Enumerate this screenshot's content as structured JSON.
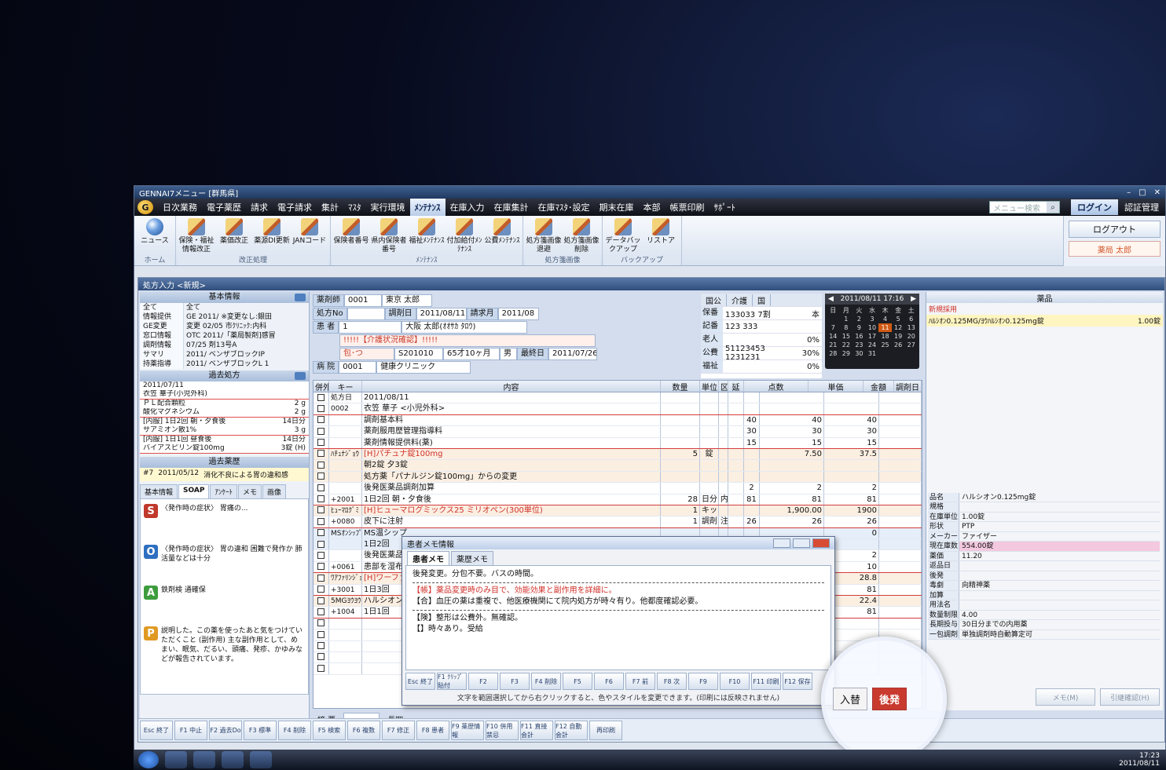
{
  "window": {
    "title": "GENNAI7メニュー [群馬県]"
  },
  "menu": {
    "items": [
      "日次業務",
      "電子薬歴",
      "請求",
      "電子請求",
      "集計",
      "ﾏｽﾀ",
      "実行環境",
      "ﾒﾝﾃﾅﾝｽ",
      "在庫入力",
      "在庫集計",
      "在庫ﾏｽﾀ･設定",
      "期末在庫",
      "本部",
      "帳票印刷",
      "ｻﾎﾟｰﾄ"
    ],
    "active_index": 7,
    "search_placeholder": "メニュー検索",
    "login": "ログイン",
    "auth": "認証管理"
  },
  "ribbon": {
    "groups": [
      {
        "label": "ホーム",
        "buttons": [
          "ニュース"
        ]
      },
      {
        "label": "改正処理",
        "buttons": [
          "保険・福祉情報改正",
          "薬価改正",
          "薬源DI更新",
          "JANコード"
        ]
      },
      {
        "label": "ﾒﾝﾃﾅﾝｽ",
        "buttons": [
          "保険者番号",
          "県内保険者番号",
          "福祉ﾒﾝﾃﾅﾝｽ",
          "付加給付ﾒﾝﾃﾅﾝｽ",
          "公費ﾒﾝﾃﾅﾝｽ"
        ]
      },
      {
        "label": "処方箋画像",
        "buttons": [
          "処方箋画像退避",
          "処方箋画像削除"
        ]
      },
      {
        "label": "バックアップ",
        "buttons": [
          "データバックアップ",
          "リストア"
        ]
      }
    ],
    "logout": "ログアウト",
    "user": "薬局 太郎"
  },
  "subwin": {
    "title": "処方入力 <新規>"
  },
  "left": {
    "basic_head": "基本情報",
    "basic": [
      {
        "k": "全て",
        "v": "全て"
      },
      {
        "k": "情報提供",
        "v": "GE  2011/ ※変更なし:銀田"
      },
      {
        "k": "GE変更",
        "v": "変更 02/05 市ｸﾘﾆｯｸ:内科"
      },
      {
        "k": "窓口情報",
        "v": "OTC 2011/「薬局製剤]感冒"
      },
      {
        "k": "調剤情報",
        "v": "07/25 剤13号A"
      },
      {
        "k": "サマリ",
        "v": "2011/ ベンザブロックIP"
      },
      {
        "k": "持薬指導",
        "v": "2011/ ベンザブロックL 1"
      }
    ],
    "past_head": "過去処方",
    "past": [
      {
        "d": "2011/07/11",
        "n": ""
      },
      {
        "d": "衣笠 華子(小児外科)",
        "n": ""
      },
      {
        "d": "ＰＬ配合顆粒",
        "n": "2 g"
      },
      {
        "d": "酸化マグネシウム",
        "n": "2 g"
      },
      {
        "d": "[内服] 1日2回 朝・夕食後",
        "n": "14日分"
      },
      {
        "d": "サアミオン散1%",
        "n": "3 g"
      },
      {
        "d": "[内服] 1日1回 昼食後",
        "n": "14日分"
      },
      {
        "d": "バイアスピリン錠100mg",
        "n": "3錠 (H)"
      }
    ],
    "hist_head": "過去薬歴",
    "hist": {
      "no": "#7",
      "date": "2011/05/12",
      "text": "消化不良による胃の違和感"
    },
    "tabs": [
      "基本情報",
      "SOAP",
      "ｱﾝｹｰﾄ",
      "メモ",
      "画像"
    ],
    "soap": [
      {
        "letter": "S",
        "color": "#c0392b",
        "text": "〈発作時の症状〉 胃痛の..."
      },
      {
        "letter": "O",
        "color": "#2e6fc0",
        "text": "〈発作時の症状〉 胃の違和 困難で発作か 肺活量などは十分"
      },
      {
        "letter": "A",
        "color": "#3d9d3d",
        "text": "鉄剤検 通確保"
      },
      {
        "letter": "P",
        "color": "#e09a22",
        "text": "説明した。この薬を使ったあと気をつけていただくこと (副作用) 主な副作用として、めまい、眠気、だるい、頭痛、発疹、かゆみなどが報告されています。"
      }
    ],
    "nav": [
      "初回",
      "前",
      "次",
      "直近"
    ]
  },
  "header": {
    "pharmacist_label": "薬剤師",
    "pharmacist_no": "0001",
    "pharmacist_name": "東京 太郎",
    "rx_label": "処方No",
    "dispense_label": "調剤日",
    "dispense_date": "2011/08/11",
    "claim_label": "請求月",
    "claim_month": "2011/08",
    "patient_label": "患 者",
    "patient_no": "1",
    "patient_name": "大阪 太郎(ｵｵｻｶ ﾀﾛｳ)",
    "alert": "!!!!!【介護状況確認】!!!!!",
    "pkg": "包･つ",
    "code": "S201010",
    "age": "65才10ヶ月",
    "sex": "男",
    "last_label": "最終日",
    "last_date": "2011/07/26",
    "hospital_label": "病 院",
    "hospital_no": "0001",
    "hospital_name": "健康クリニック"
  },
  "insurance": {
    "tabs": [
      "国公",
      "介護",
      "国"
    ],
    "rows": [
      {
        "a": "保番",
        "b": "133033  7割",
        "c": "本"
      },
      {
        "a": "記番",
        "b": "123 333",
        "c": ""
      },
      {
        "a": "老人",
        "b": "",
        "c": "0%"
      },
      {
        "a": "公費",
        "b": "51123453 1231231",
        "c": "30%"
      },
      {
        "a": "福祉",
        "b": "",
        "c": "0%"
      }
    ]
  },
  "calendar": {
    "head": "2011/08/11 17:16",
    "days": [
      "日",
      "月",
      "火",
      "水",
      "木",
      "金",
      "土"
    ],
    "dates": [
      "",
      "1",
      "2",
      "3",
      "4",
      "5",
      "6",
      "7",
      "8",
      "9",
      "10",
      "11",
      "12",
      "13",
      "14",
      "15",
      "16",
      "17",
      "18",
      "19",
      "20",
      "21",
      "22",
      "23",
      "24",
      "25",
      "26",
      "27",
      "28",
      "29",
      "30",
      "31",
      "",
      "",
      ""
    ],
    "today": "11"
  },
  "grid": {
    "headers": [
      "併外",
      "キー",
      "内容",
      "数量",
      "単位",
      "区",
      "延",
      "点数",
      "単価",
      "金額",
      "調剤日"
    ],
    "rows": [
      {
        "k": "処方日",
        "c": "2011/08/11",
        "q": "",
        "u": "",
        "t": "",
        "d": "",
        "p": "",
        "pr": "",
        "a": "",
        "cls": "",
        "tx": ""
      },
      {
        "k": "0002",
        "c": "衣笠 華子 <小児外科>",
        "q": "",
        "u": "",
        "t": "",
        "d": "",
        "p": "",
        "pr": "",
        "a": "",
        "cls": "red",
        "tx": ""
      },
      {
        "k": "",
        "c": "調剤基本料",
        "q": "",
        "u": "",
        "t": "",
        "d": "",
        "p": "40",
        "pr": "40",
        "a": "40",
        "cls": "",
        "tx": ""
      },
      {
        "k": "",
        "c": "薬剤服用歴管理指導料",
        "q": "",
        "u": "",
        "t": "",
        "d": "",
        "p": "30",
        "pr": "30",
        "a": "30",
        "cls": "",
        "tx": ""
      },
      {
        "k": "",
        "c": "薬剤情報提供料(薬)",
        "q": "",
        "u": "",
        "t": "",
        "d": "",
        "p": "15",
        "pr": "15",
        "a": "15",
        "cls": "red",
        "tx": ""
      },
      {
        "k": "ﾊﾁｭﾅｼﾞｮｳ",
        "c": "[H]パチュナ錠100mg",
        "q": "5",
        "u": "錠",
        "t": "",
        "d": "",
        "p": "",
        "pr": "7.50",
        "a": "37.5",
        "cls": "beige",
        "tx": "red"
      },
      {
        "k": "",
        "c": "朝2錠 夕3錠",
        "q": "",
        "u": "",
        "t": "",
        "d": "",
        "p": "",
        "pr": "",
        "a": "",
        "cls": "beige",
        "tx": ""
      },
      {
        "k": "",
        "c": "処方薬「パナルジン錠100mg」からの変更",
        "q": "",
        "u": "",
        "t": "",
        "d": "",
        "p": "",
        "pr": "",
        "a": "",
        "cls": "beige",
        "tx": ""
      },
      {
        "k": "",
        "c": "後発医薬品調剤加算",
        "q": "",
        "u": "",
        "t": "",
        "d": "",
        "p": "2",
        "pr": "2",
        "a": "2",
        "cls": "",
        "tx": ""
      },
      {
        "k": "+2001",
        "c": "1日2回 朝・夕食後",
        "q": "28",
        "u": "日分",
        "t": "内",
        "d": "",
        "p": "81",
        "pr": "81",
        "a": "81",
        "cls": "red",
        "tx": ""
      },
      {
        "k": "ﾋｭｰﾏﾛｸﾞﾐ",
        "c": "[H]ヒューマログミックス25 ミリオペン(300単位)",
        "q": "1",
        "u": "キッ",
        "t": "",
        "d": "",
        "p": "",
        "pr": "1,900.00",
        "a": "1900",
        "cls": "beige",
        "tx": "red"
      },
      {
        "k": "+0080",
        "c": "皮下に注射",
        "q": "1",
        "u": "調剤",
        "t": "注",
        "d": "",
        "p": "26",
        "pr": "26",
        "a": "26",
        "cls": "red",
        "tx": ""
      },
      {
        "k": "MSｵﾝｼｯﾌﾟ",
        "c": "MS温シップ",
        "q": "",
        "u": "",
        "t": "",
        "d": "",
        "p": "",
        "pr": "",
        "a": "0",
        "cls": "blue",
        "tx": ""
      },
      {
        "k": "",
        "c": "1日2回",
        "q": "",
        "u": "",
        "t": "",
        "d": "",
        "p": "",
        "pr": "",
        "a": "",
        "cls": "blue",
        "tx": ""
      },
      {
        "k": "",
        "c": "後発医薬品調剤加算",
        "q": "",
        "u": "",
        "t": "",
        "d": "",
        "p": "",
        "pr": "",
        "a": "2",
        "cls": "",
        "tx": ""
      },
      {
        "k": "+0061",
        "c": "患部を湿布",
        "q": "",
        "u": "",
        "t": "",
        "d": "",
        "p": "",
        "pr": "",
        "a": "10",
        "cls": "red",
        "tx": ""
      },
      {
        "k": "ﾜｱﾌｧﾘﾝｼﾞｮ",
        "c": "[H]ワーファリン錠",
        "q": "",
        "u": "",
        "t": "",
        "d": "",
        "p": "",
        "pr": "",
        "a": "28.8",
        "cls": "beige",
        "tx": "red"
      },
      {
        "k": "+3001",
        "c": "1日3回",
        "q": "",
        "u": "",
        "t": "",
        "d": "",
        "p": "",
        "pr": "",
        "a": "81",
        "cls": "red",
        "tx": ""
      },
      {
        "k": "5MGﾖｳﾖｳ",
        "c": "ハルシオン",
        "q": "",
        "u": "",
        "t": "",
        "d": "",
        "p": "",
        "pr": "",
        "a": "22.4",
        "cls": "beige",
        "tx": ""
      },
      {
        "k": "+1004",
        "c": "1日1回",
        "q": "",
        "u": "",
        "t": "",
        "d": "",
        "p": "",
        "pr": "",
        "a": "81",
        "cls": "red",
        "tx": ""
      },
      {
        "k": "",
        "c": "",
        "q": "",
        "u": "",
        "t": "",
        "d": "",
        "p": "",
        "pr": "",
        "a": "",
        "cls": "",
        "tx": ""
      },
      {
        "k": "",
        "c": "",
        "q": "",
        "u": "",
        "t": "",
        "d": "",
        "p": "",
        "pr": "",
        "a": "",
        "cls": "",
        "tx": ""
      },
      {
        "k": "",
        "c": "",
        "q": "",
        "u": "",
        "t": "",
        "d": "",
        "p": "",
        "pr": "",
        "a": "",
        "cls": "",
        "tx": ""
      },
      {
        "k": "",
        "c": "",
        "q": "",
        "u": "",
        "t": "",
        "d": "",
        "p": "",
        "pr": "",
        "a": "",
        "cls": "",
        "tx": ""
      },
      {
        "k": "",
        "c": "",
        "q": "",
        "u": "",
        "t": "",
        "d": "",
        "p": "",
        "pr": "",
        "a": "",
        "cls": "",
        "tx": ""
      }
    ]
  },
  "summary": {
    "label": "摘 要",
    "label2": "長期"
  },
  "fkeys": [
    "Esc 終了",
    "F1 中止",
    "F2 過去Do",
    "F3 標準",
    "F4 削除",
    "F5 検索",
    "F6 複数",
    "F7 修正",
    "F8 患者",
    "F9 薬歴情報",
    "F10 併用禁忌",
    "F11 直接会計",
    "F12 自動会計",
    "再印刷"
  ],
  "right": {
    "head": "薬品",
    "newtag": "新規採用",
    "drug": "ﾊﾙｼｵﾝ0.125MG/ﾖｳﾊﾙｼｵﾝ0.125mg錠",
    "qty": "1.00錠",
    "details": [
      {
        "k": "品名",
        "v": "ハルシオン0.125mg錠",
        "pink": false
      },
      {
        "k": "規格",
        "v": "",
        "pink": false
      },
      {
        "k": "在庫単位",
        "v": "1.00錠",
        "pink": false
      },
      {
        "k": "形状",
        "v": "PTP",
        "pink": false
      },
      {
        "k": "メーカー",
        "v": "ファイザー",
        "pink": false
      },
      {
        "k": "現在庫数",
        "v": "554.00錠",
        "pink": true
      },
      {
        "k": "薬価",
        "v": "11.20",
        "pink": false
      },
      {
        "k": "返品日",
        "v": "",
        "pink": false
      },
      {
        "k": "後発",
        "v": "",
        "pink": false
      },
      {
        "k": "毒劇",
        "v": "向精神薬",
        "pink": false
      },
      {
        "k": "加算",
        "v": "",
        "pink": false
      },
      {
        "k": "用法名",
        "v": "",
        "pink": false
      },
      {
        "k": "数量制限",
        "v": "4.00",
        "pink": false
      },
      {
        "k": "長期投与",
        "v": "30日分までの内用薬",
        "pink": false
      },
      {
        "k": "一包調剤",
        "v": "単独調剤時自動算定可",
        "pink": false
      }
    ],
    "btn1": "メモ(M)",
    "btn2": "引継確認(H)"
  },
  "popup": {
    "title": "患者メモ情報",
    "tabs": [
      "患者メモ",
      "薬歴メモ"
    ],
    "lines": [
      {
        "t": "後発変更。分包不要。バスの時間。",
        "red": false
      },
      {
        "t": "dash",
        "red": false
      },
      {
        "t": "【帳】薬品変更時のみ目で、効能効果と副作用を詳細に。",
        "red": true
      },
      {
        "t": "【合】血圧の薬は重複で、他医療機関にて院内処方が時々有り。他都度確認必要。",
        "red": false
      },
      {
        "t": "dash",
        "red": false
      },
      {
        "t": "【険】整形は公費外。無確認。",
        "red": false
      },
      {
        "t": "【】時々あり。受給",
        "red": false
      }
    ],
    "fkeys": [
      "Esc 終了",
      "F1 ｸﾘｯﾌﾟ貼付",
      "F2",
      "F3",
      "F4 削除",
      "F5",
      "F6",
      "F7 前",
      "F8 次",
      "F9",
      "F10",
      "F11 印刷",
      "F12 保存"
    ],
    "hint": "文字を範囲選択してから右クリックすると、色やスタイルを変更できます。(印刷には反映されません)"
  },
  "callout": {
    "button1": "入替",
    "button2": "後発"
  },
  "taskbar": {
    "time": "17:23",
    "date": "2011/08/11"
  }
}
